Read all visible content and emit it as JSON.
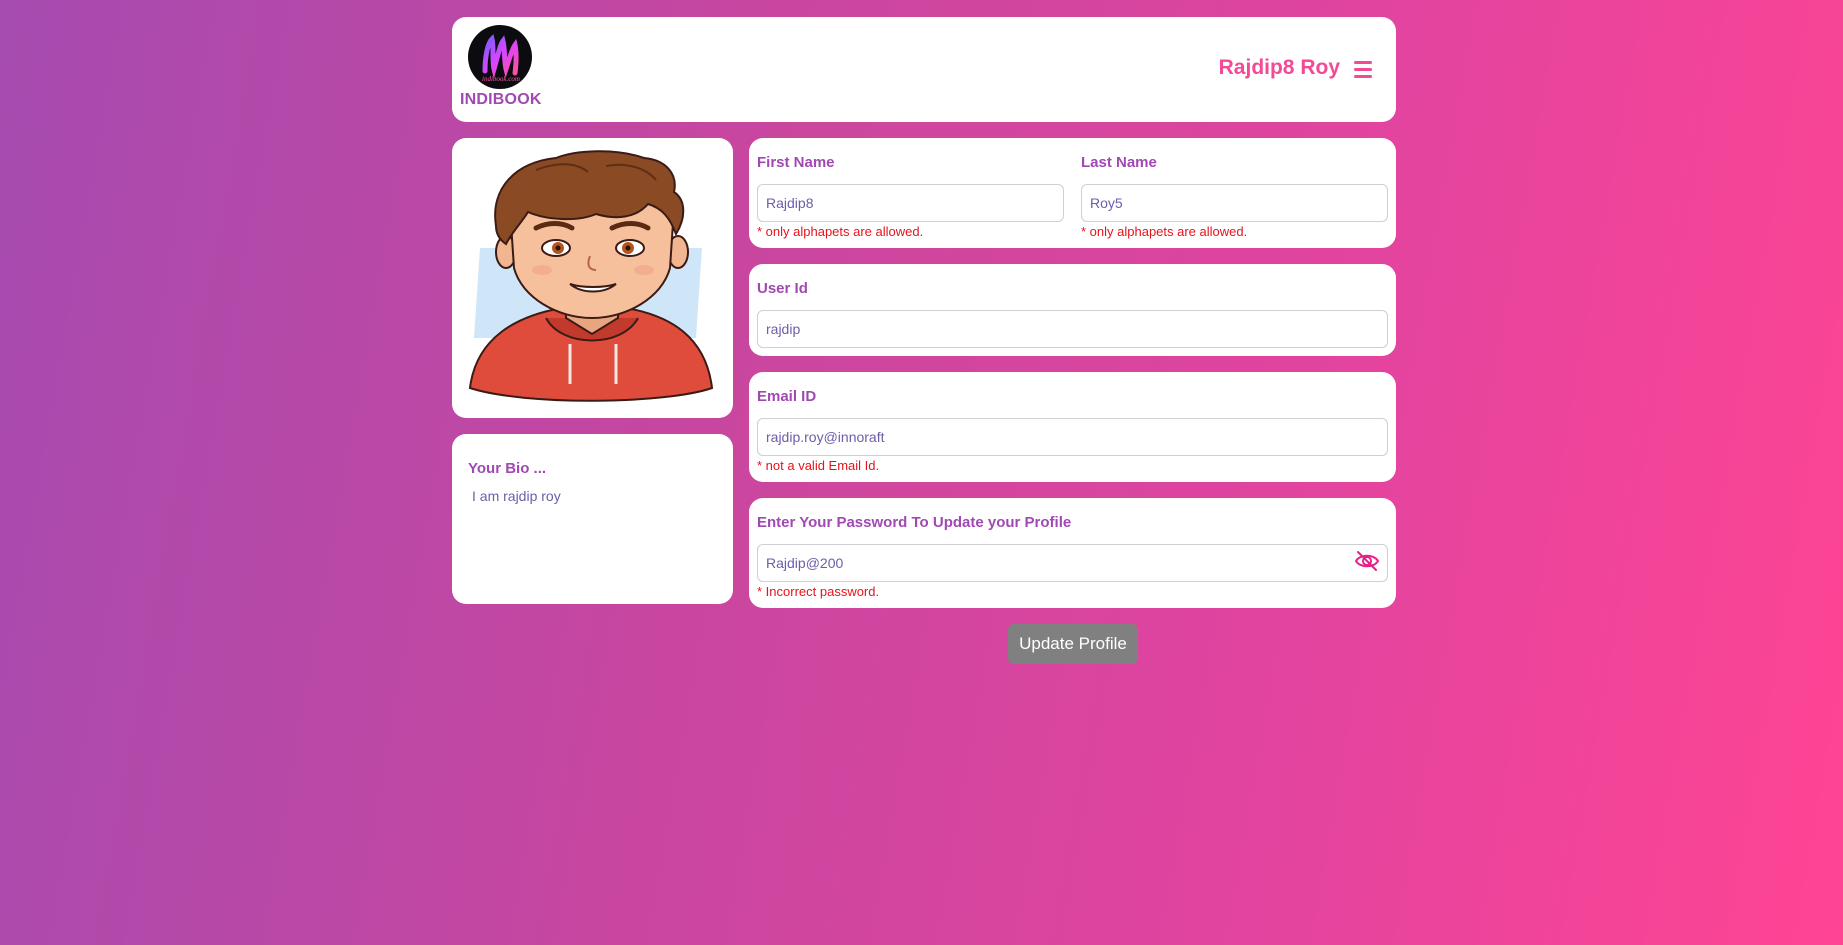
{
  "header": {
    "brand": "INDIBOOK",
    "logo_text": "indibook.com",
    "user_name": "Rajdip8 Roy"
  },
  "bio": {
    "title": "Your Bio ...",
    "text": "I am rajdip roy"
  },
  "form": {
    "first_name": {
      "label": "First Name",
      "value": "Rajdip8",
      "error": "* only alphapets are allowed."
    },
    "last_name": {
      "label": "Last Name",
      "value": "Roy5",
      "error": "* only alphapets are allowed."
    },
    "user_id": {
      "label": "User Id",
      "value": "rajdip"
    },
    "email": {
      "label": "Email ID",
      "value": "rajdip.roy@innoraft",
      "error": "* not a valid Email Id."
    },
    "password": {
      "label": "Enter Your Password To Update your Profile",
      "value": "Rajdip@200",
      "error": "* Incorrect password."
    },
    "submit_label": "Update Profile"
  },
  "icons": {
    "menu": "hamburger-icon",
    "password_toggle": "eye-slash-icon"
  },
  "colors": {
    "brand_purple": "#a049b2",
    "brand_pink": "#f24a95",
    "error_red": "#e8121b",
    "button_gray": "#808080"
  }
}
